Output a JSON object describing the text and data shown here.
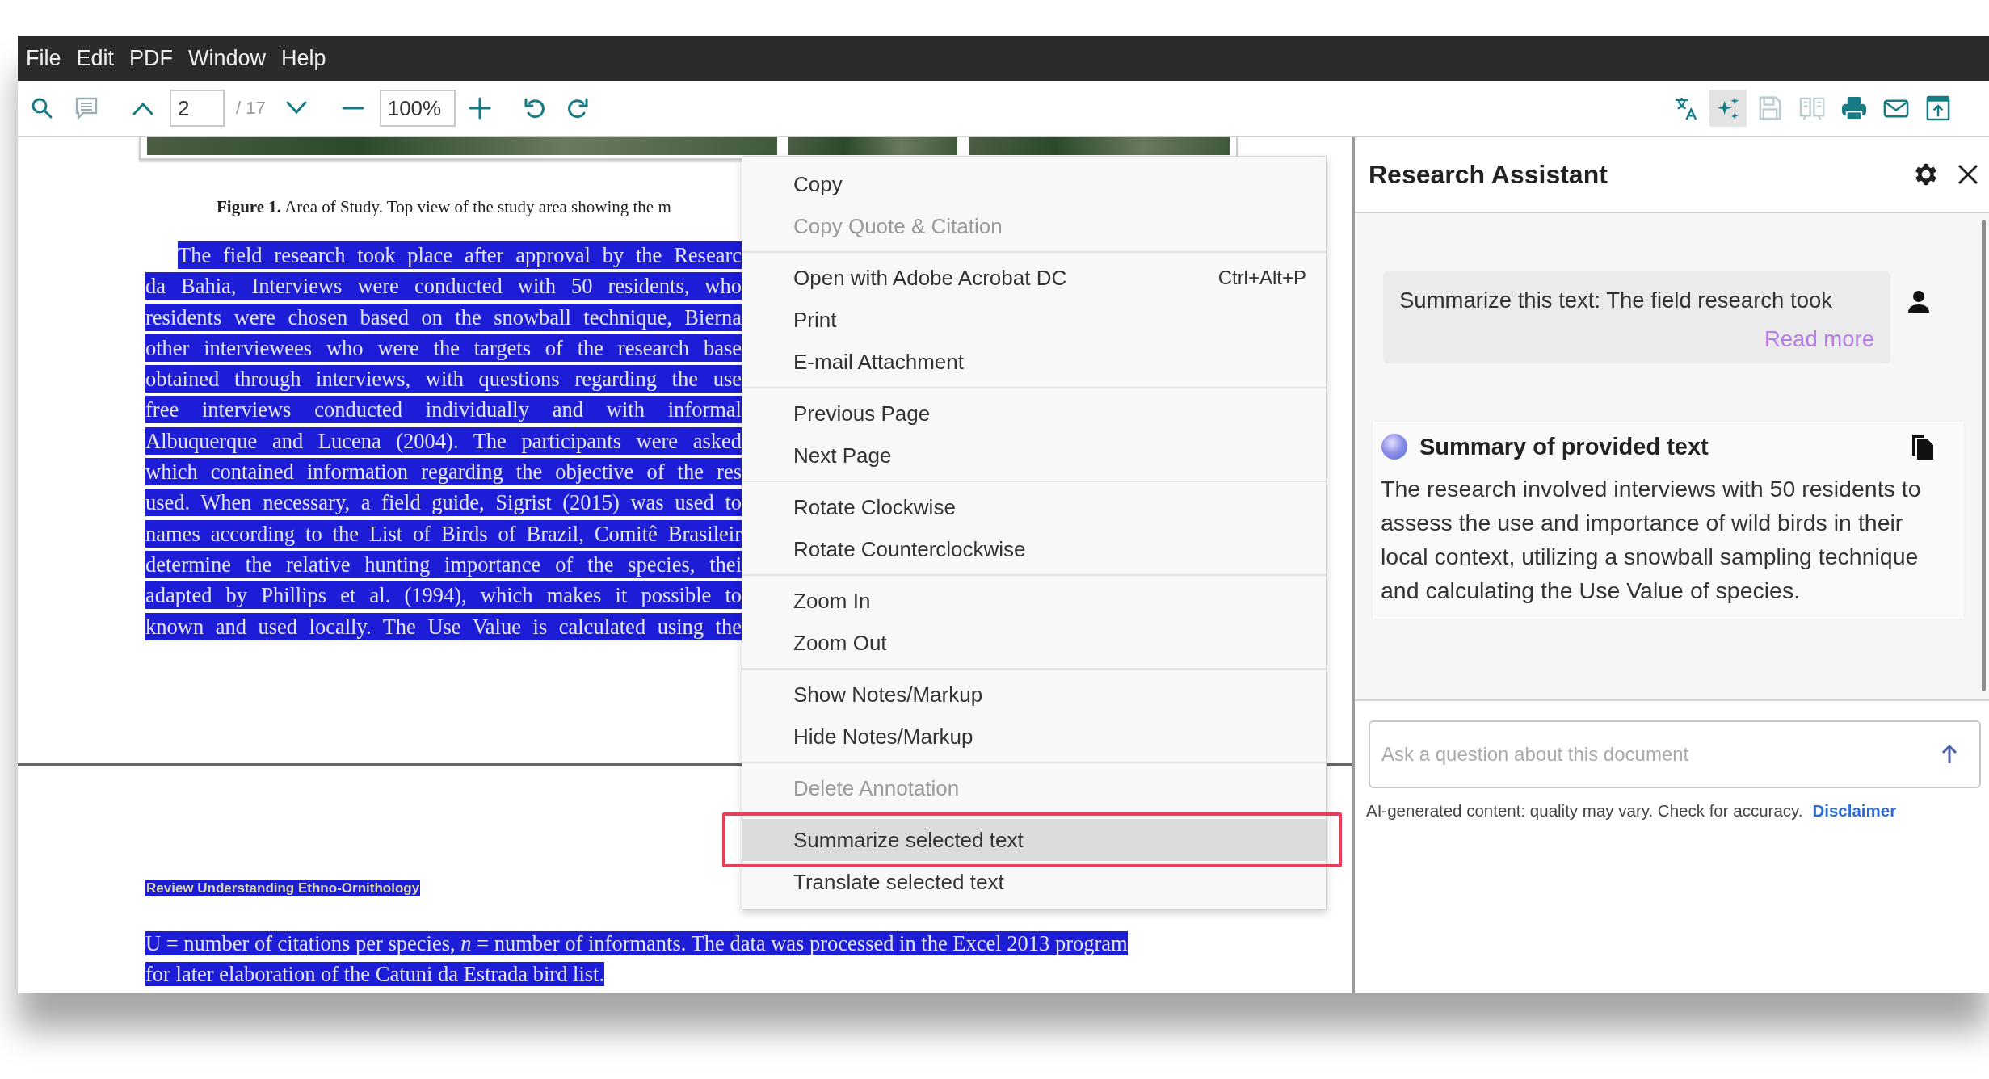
{
  "menu_bar": [
    "File",
    "Edit",
    "PDF",
    "Window",
    "Help"
  ],
  "toolbar": {
    "page_field": {
      "value": "2"
    },
    "page_count": "/ 17",
    "zoom_field": {
      "value": "100%"
    },
    "right_tools": [
      {
        "kind": "translate",
        "selected": false,
        "disabled": false
      },
      {
        "kind": "sparkle",
        "selected": true,
        "disabled": false
      },
      {
        "kind": "save",
        "selected": false,
        "disabled": true
      },
      {
        "kind": "compare",
        "selected": false,
        "disabled": true
      },
      {
        "kind": "print",
        "selected": false,
        "disabled": false
      },
      {
        "kind": "mail",
        "selected": false,
        "disabled": false
      },
      {
        "kind": "export",
        "selected": false,
        "disabled": false
      }
    ]
  },
  "document": {
    "caption": "**Figure 1.** Area of Study. Top view of the study area showing the m",
    "paragraph": {
      "highlighted": true,
      "lines": [
        "The field research took place after approval by the Researc",
        "da Bahia, Interviews were conducted with 50 residents, who",
        "residents were chosen based on the snowball technique, Bierna",
        "other interviewees who were the targets of the research base",
        "obtained through interviews, with questions regarding the use",
        "free interviews conducted individually and with informal",
        "Albuquerque and Lucena (2004). The participants were asked",
        "which contained information regarding the objective of the res",
        "used. When necessary, a field guide, Sigrist (2015) was used to",
        "names according to the List of Birds of Brazil, Comitê Brasileir",
        "determine the relative hunting importance of the species, thei",
        "adapted by Phillips et al. (1994), which makes it possible to",
        "known and used locally. The Use Value is calculated using the"
      ]
    },
    "heading": {
      "text": "Review Understanding Ethno-Ornithology",
      "highlighted": true
    },
    "paragraph_2": {
      "highlighted": true,
      "lines": [
        "U = number of citations per species, *n* = number of informants. The data was processed in the Excel 2013 program",
        "for later elaboration of the Catuni da Estrada bird list."
      ]
    }
  },
  "context_menu": {
    "groups": [
      [
        {
          "label": "Copy",
          "disabled": false,
          "selected": false,
          "outlined": false
        },
        {
          "label": "Copy Quote & Citation",
          "disabled": true,
          "selected": false,
          "outlined": false
        }
      ],
      [
        {
          "label": "Open with Adobe Acrobat DC",
          "shortcut": "Ctrl+Alt+P",
          "disabled": false,
          "selected": false,
          "outlined": false
        },
        {
          "label": "Print",
          "disabled": false,
          "selected": false,
          "outlined": false
        },
        {
          "label": "E-mail Attachment",
          "disabled": false,
          "selected": false,
          "outlined": false
        }
      ],
      [
        {
          "label": "Previous Page",
          "disabled": false,
          "selected": false,
          "outlined": false
        },
        {
          "label": "Next Page",
          "disabled": false,
          "selected": false,
          "outlined": false
        }
      ],
      [
        {
          "label": "Rotate Clockwise",
          "disabled": false,
          "selected": false,
          "outlined": false
        },
        {
          "label": "Rotate Counterclockwise",
          "disabled": false,
          "selected": false,
          "outlined": false
        }
      ],
      [
        {
          "label": "Zoom In",
          "disabled": false,
          "selected": false,
          "outlined": false
        },
        {
          "label": "Zoom Out",
          "disabled": false,
          "selected": false,
          "outlined": false
        }
      ],
      [
        {
          "label": "Show Notes/Markup",
          "disabled": false,
          "selected": false,
          "outlined": false
        },
        {
          "label": "Hide Notes/Markup",
          "disabled": false,
          "selected": false,
          "outlined": false
        }
      ],
      [
        {
          "label": "Delete Annotation",
          "disabled": true,
          "selected": false,
          "outlined": false
        }
      ],
      [
        {
          "label": "Summarize selected text",
          "disabled": false,
          "selected": true,
          "outlined": true
        },
        {
          "label": "Translate selected text",
          "disabled": false,
          "selected": false,
          "outlined": false
        }
      ]
    ]
  },
  "assistant": {
    "title": "Research Assistant",
    "user_message": {
      "text": "Summarize this text: The field research took",
      "link": "Read more"
    },
    "summary": {
      "title": "Summary of provided text",
      "text": "The research involved interviews with 50 residents to assess the use and importance of wild birds in their local context, utilizing a snowball sampling technique and calculating the Use Value of species."
    },
    "input": {
      "placeholder": "Ask a question about this document"
    },
    "disclaimer": {
      "text": "AI-generated content: quality may vary. Check for accuracy.",
      "link": "Disclaimer"
    }
  }
}
